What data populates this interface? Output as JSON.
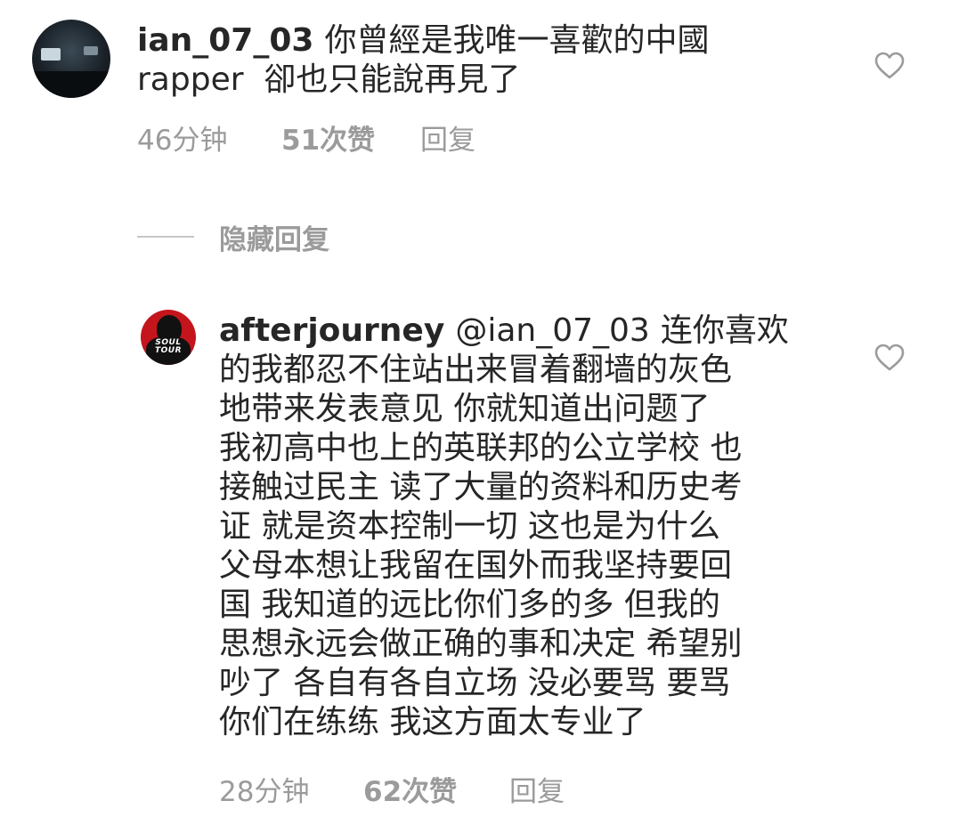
{
  "comments": [
    {
      "username": "ian_07_03",
      "lines": [
        "你曾經是我唯一喜歡的中國",
        "rapper  卻也只能說再見了"
      ],
      "time": "46分钟",
      "likes": "51次赞",
      "reply_label": "回复",
      "avatar_icon": "avatar-icon"
    },
    {
      "username": "afterjourney",
      "mention": "@ian_07_03",
      "lines": [
        "连你喜欢",
        "的我都忍不住站出来冒着翻墙的灰色",
        "地带来发表意见 你就知道出问题了",
        "我初高中也上的英联邦的公立学校 也",
        "接触过民主 读了大量的资料和历史考",
        "证 就是资本控制一切 这也是为什么",
        "父母本想让我留在国外而我坚持要回",
        "国 我知道的远比你们多的多 但我的",
        "思想永远会做正确的事和决定 希望别",
        "吵了 各自有各自立场 没必要骂 要骂",
        "你们在练练 我这方面太专业了"
      ],
      "avatar_text": [
        "SOUL",
        "TOUR"
      ],
      "time": "28分钟",
      "likes": "62次赞",
      "reply_label": "回复"
    }
  ],
  "hidden_replies_label": "隐藏回复",
  "colors": {
    "text": "#262626",
    "meta": "#9b9b9b",
    "divider": "#c7c7c7",
    "avatar_red": "#c4151c"
  },
  "icons": {
    "like": "heart-outline-icon"
  }
}
